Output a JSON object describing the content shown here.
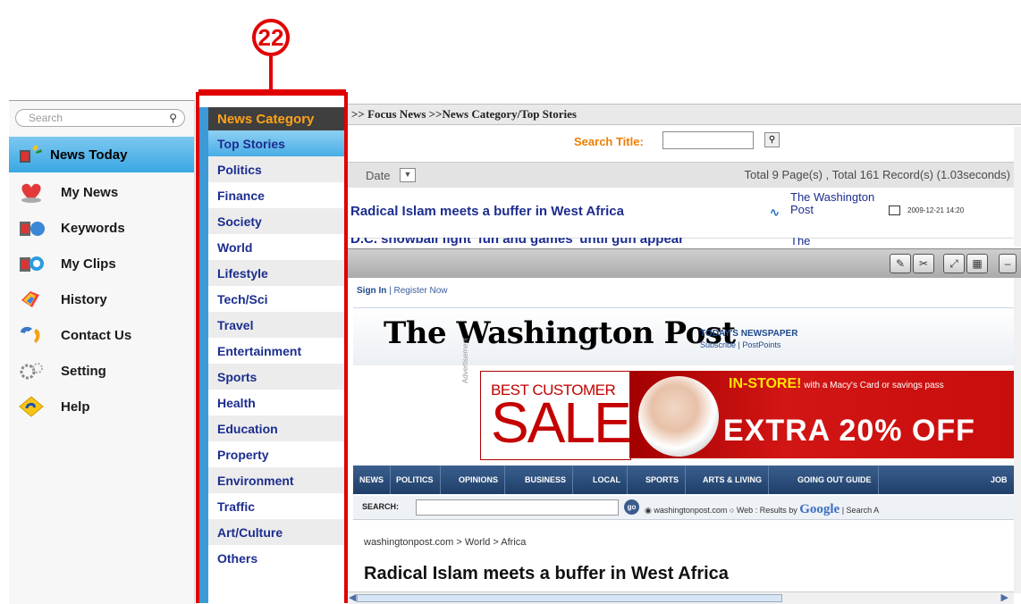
{
  "callout": {
    "number": "22"
  },
  "left_nav": {
    "search_placeholder": "Search",
    "items": [
      {
        "label": "News Today",
        "icon": "news-today-icon",
        "active": true
      },
      {
        "label": "My News",
        "icon": "heart-icon"
      },
      {
        "label": "Keywords",
        "icon": "keywords-icon"
      },
      {
        "label": "My Clips",
        "icon": "clips-icon"
      },
      {
        "label": "History",
        "icon": "history-icon"
      },
      {
        "label": "Contact Us",
        "icon": "phone-icon"
      },
      {
        "label": "Setting",
        "icon": "gear-icon"
      },
      {
        "label": "Help",
        "icon": "help-icon"
      }
    ]
  },
  "category": {
    "header": "News Category",
    "items": [
      "Top Stories",
      "Politics",
      "Finance",
      "Society",
      "World",
      "Lifestyle",
      "Tech/Sci",
      "Travel",
      "Entertainment",
      "Sports",
      "Health",
      "Education",
      "Property",
      "Environment",
      "Traffic",
      "Art/Culture",
      "Others"
    ],
    "selected": "Top Stories"
  },
  "breadcrumb": ">> Focus News >>News Category/Top Stories",
  "search": {
    "label": "Search Title:",
    "value": ""
  },
  "list_header": {
    "sort_label": "Date",
    "totals": "Total 9 Page(s) , Total 161 Record(s) (1.03seconds)"
  },
  "news": [
    {
      "title": "Radical Islam meets a buffer in West Africa",
      "source": "The Washington Post",
      "date": "2009-12-21 14:20"
    },
    {
      "title": "D.C. snowball fight 'fun and games' until gun appear",
      "source": "The"
    }
  ],
  "browser": {
    "signin": "Sign In",
    "register": " | Register Now",
    "logo": "The Washington Post",
    "todays_paper": "TODAY'S NEWSPAPER",
    "subscribe": "Subscribe | PostPoints",
    "ad_vertical": "Advertisement",
    "ad_best": "BEST CUSTOMER",
    "ad_sale": "SALE",
    "ad_instore": "IN-STORE!",
    "ad_instore_sub": " with a Macy's Card or savings pass",
    "ad_extra": "EXTRA 20% OFF",
    "nav": [
      "NEWS",
      "POLITICS",
      "OPINIONS",
      "BUSINESS",
      "LOCAL",
      "SPORTS",
      "ARTS & LIVING",
      "GOING OUT GUIDE",
      "JOB"
    ],
    "search_label": "SEARCH:",
    "go": "go",
    "search_opts_1": " washingtonpost.com  ",
    "search_opts_2": " Web : Results by ",
    "google": "Google",
    "search_opts_3": "  |  Search A",
    "crumb": "washingtonpost.com > World > Africa",
    "article_title": "Radical Islam meets a buffer in West Africa"
  }
}
